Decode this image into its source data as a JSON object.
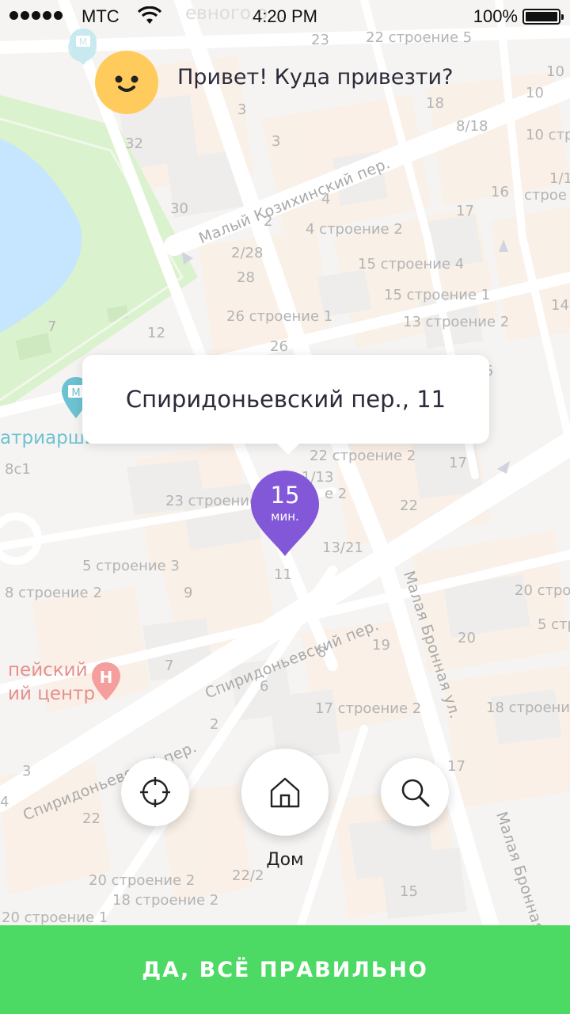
{
  "status_bar": {
    "carrier": "МТС",
    "time": "4:20 PM",
    "battery": "100%"
  },
  "greeting": {
    "text": "Привет! Куда привезти?"
  },
  "address": {
    "text": "Спиридоньевский пер., 11"
  },
  "pin": {
    "minutes": "15",
    "unit": "мин."
  },
  "buttons": {
    "home_label": "Дом"
  },
  "confirm": {
    "label": "ДА, ВСЁ ПРАВИЛЬНО"
  },
  "map": {
    "streets": {
      "maly_kozikhinsky": "Малый Козихинский пер.",
      "spiridonyevsky_1": "Спиридоньевский пер.",
      "spiridonyevsky_2": "Спиридоньевский пер.",
      "malaya_bronnaya_1": "Малая Бронная ул.",
      "malaya_bronnaya_2": "Малая Бронная"
    },
    "poi": {
      "patriarshie": "атриарши",
      "center_line1": "пейский",
      "center_line2": "ий центр",
      "top_clipped": "евного о..."
    },
    "labels": {
      "l1": "23",
      "l2": "22 строение 5",
      "l3": "10",
      "l4": "10",
      "l5": "18",
      "l6": "3",
      "l7": "8/18",
      "l8": "32",
      "l9": "3",
      "l10": "10 стр",
      "l11": "1/1",
      "l12": "строе",
      "l13": "16",
      "l14": "4",
      "l15": "17",
      "l16": "30",
      "l17": "2",
      "l18": "4 строение 2",
      "l19": "2/28",
      "l20": "15 строение 4",
      "l21": "28",
      "l22": "15 строение 1",
      "l23": "14",
      "l24": "26 строение 1",
      "l25": "13 строение 2",
      "l26": "7",
      "l27": "12",
      "l28": "26",
      "l29": "5",
      "l30": "8с1",
      "l31": "22 строение 2",
      "l32": "17",
      "l33": "1/13",
      "l34": "23 строение",
      "l35": "е 2",
      "l36": "22",
      "l37": "13/21",
      "l38": "5 строение 3",
      "l39": "11",
      "l40": "20 стро",
      "l41": "8 строение 2",
      "l42": "9",
      "l43": "5 стр",
      "l44": "20",
      "l45": "19",
      "l46": "8",
      "l47": "7",
      "l48": "6",
      "l49": "17 строение 2",
      "l50": "18 строение",
      "l51": "2",
      "l52": "17",
      "l53": "3",
      "l54": "22",
      "l55": "20 строение 2",
      "l56": "22/2",
      "l57": "18 строение 2",
      "l58": "15",
      "l59": "20 строение 1",
      "l60": "4"
    }
  },
  "colors": {
    "accent_pin": "#8358d8",
    "confirm_bg": "#4cd964",
    "avatar_bg": "#ffcb5c",
    "park": "#c8ebb4",
    "water": "#a8d8ff"
  }
}
